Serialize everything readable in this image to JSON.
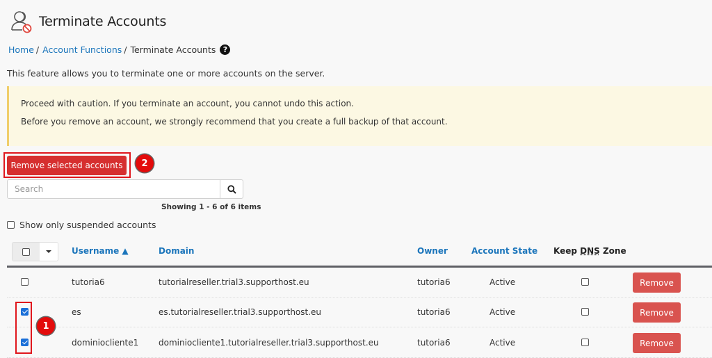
{
  "page": {
    "title": "Terminate Accounts",
    "title_icon": "user-terminate-icon"
  },
  "breadcrumb": {
    "home": "Home",
    "separator": "/",
    "account_functions": "Account Functions",
    "current": "Terminate Accounts",
    "help_icon": "question-circle-icon",
    "help_glyph": "?"
  },
  "intro": "This feature allows you to terminate one or more accounts on the server.",
  "warning": {
    "line1": "Proceed with caution. If you terminate an account, you cannot undo this action.",
    "line2": "Before you remove an account, we strongly recommend that you create a full backup of that account."
  },
  "actions": {
    "remove_selected_label": "Remove selected accounts"
  },
  "search": {
    "placeholder": "Search",
    "value": "",
    "icon": "search-icon"
  },
  "pagination": {
    "showing": "Showing 1 - 6 of 6 items"
  },
  "filters": {
    "suspended_only_label": "Show only suspended accounts",
    "suspended_only_checked": false
  },
  "table": {
    "columns": {
      "username": "Username ▲",
      "domain": "Domain",
      "owner": "Owner",
      "account_state": "Account State",
      "keep_dns_prefix": "Keep ",
      "keep_dns_abbr": "DNS",
      "keep_dns_suffix": " Zone"
    },
    "rows": [
      {
        "selected": false,
        "username": "tutoria6",
        "domain": "tutorialreseller.trial3.supporthost.eu",
        "owner": "tutoria6",
        "state": "Active",
        "keep_dns": false,
        "action": "Remove"
      },
      {
        "selected": true,
        "username": "es",
        "domain": "es.tutorialreseller.trial3.supporthost.eu",
        "owner": "tutoria6",
        "state": "Active",
        "keep_dns": false,
        "action": "Remove"
      },
      {
        "selected": true,
        "username": "dominiocliente1",
        "domain": "dominiocliente1.tutorialreseller.trial3.supporthost.eu",
        "owner": "tutoria6",
        "state": "Active",
        "keep_dns": false,
        "action": "Remove"
      }
    ]
  },
  "annotations": {
    "step1": "1",
    "step2": "2"
  },
  "colors": {
    "link": "#1b75bb",
    "danger": "#d9534f",
    "annotation": "#e30b0b",
    "warning_bg": "#fcf8e3"
  }
}
